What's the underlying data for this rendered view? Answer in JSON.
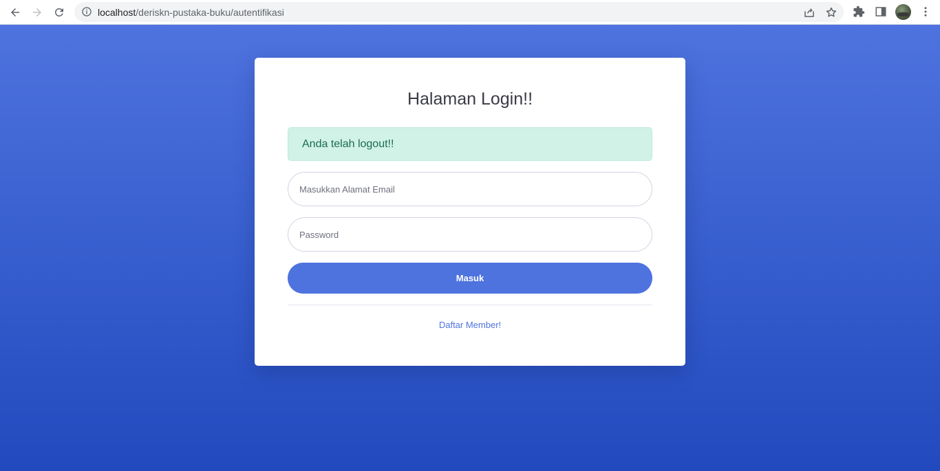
{
  "browser": {
    "url_host": "localhost",
    "url_path": "/deriskn-pustaka-buku/autentifikasi",
    "icons": [
      "back-arrow-icon",
      "forward-arrow-icon",
      "reload-icon",
      "info-icon",
      "share-icon",
      "star-icon",
      "extensions-icon",
      "side-panel-icon",
      "avatar",
      "more-vert-icon"
    ]
  },
  "login": {
    "title": "Halaman Login!!",
    "alert": "Anda telah logout!!",
    "email_placeholder": "Masukkan Alamat Email",
    "password_placeholder": "Password",
    "submit_label": "Masuk",
    "register_link": "Daftar Member!"
  },
  "colors": {
    "primary": "#4e73df",
    "gradient_end": "#224abe",
    "alert_bg": "#d1f2e6",
    "alert_text": "#1a6b52"
  }
}
